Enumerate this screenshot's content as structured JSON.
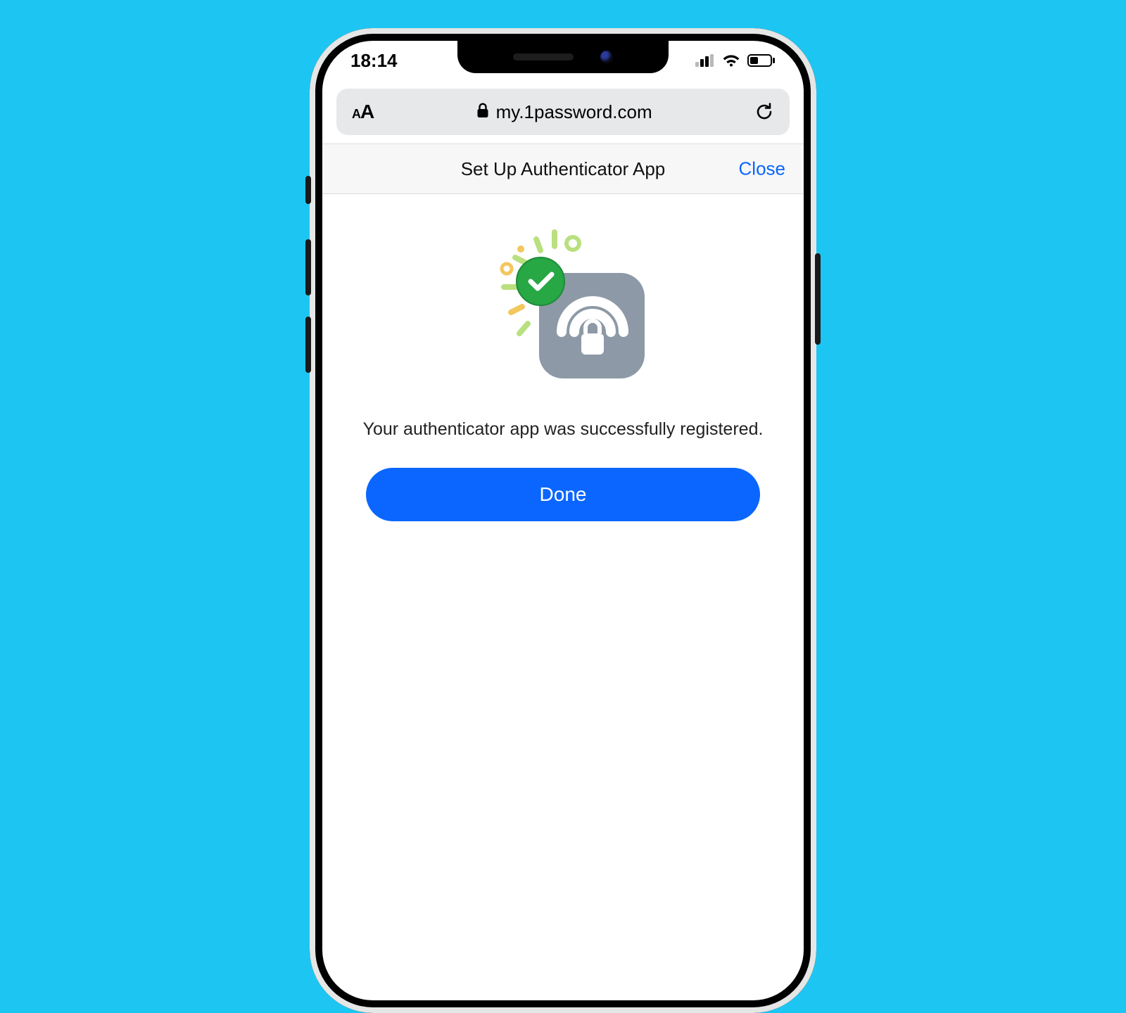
{
  "status_bar": {
    "time": "18:14"
  },
  "browser": {
    "url_display": "my.1password.com"
  },
  "modal": {
    "title": "Set Up Authenticator App",
    "close_label": "Close",
    "success_message": "Your authenticator app was successfully registered.",
    "done_label": "Done"
  },
  "colors": {
    "background": "#1dc6f2",
    "accent_blue": "#0a66ff",
    "success_green": "#28a745"
  }
}
